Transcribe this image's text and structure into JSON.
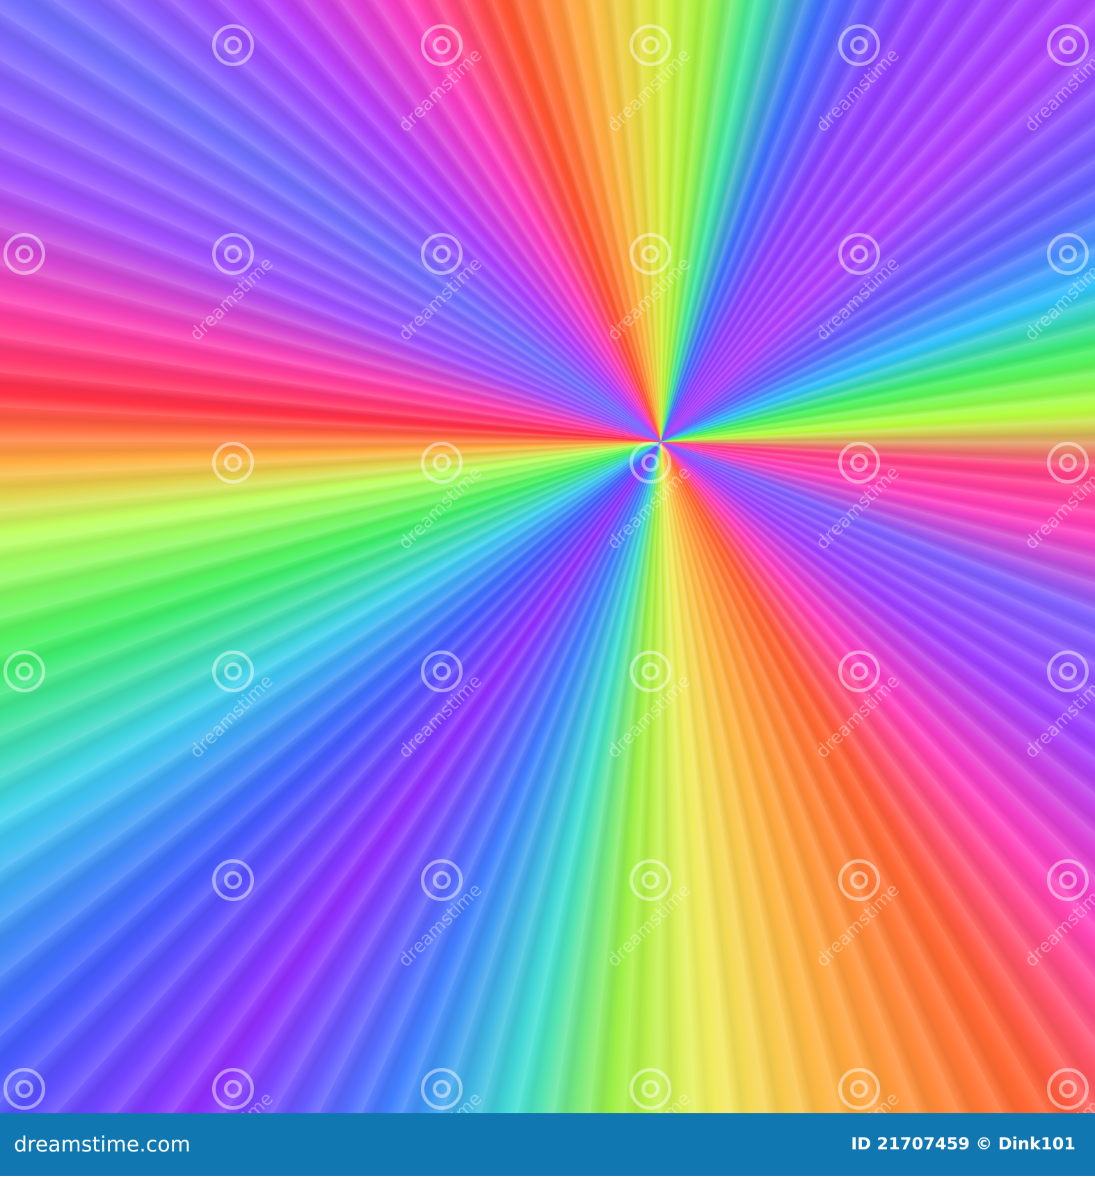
{
  "watermark": {
    "text": "dreamstime"
  },
  "footer": {
    "logo": "dreamstime.com",
    "credit": "ID 21707459 © Dink101"
  },
  "colors": {
    "footer_bg": "#1077b0"
  }
}
